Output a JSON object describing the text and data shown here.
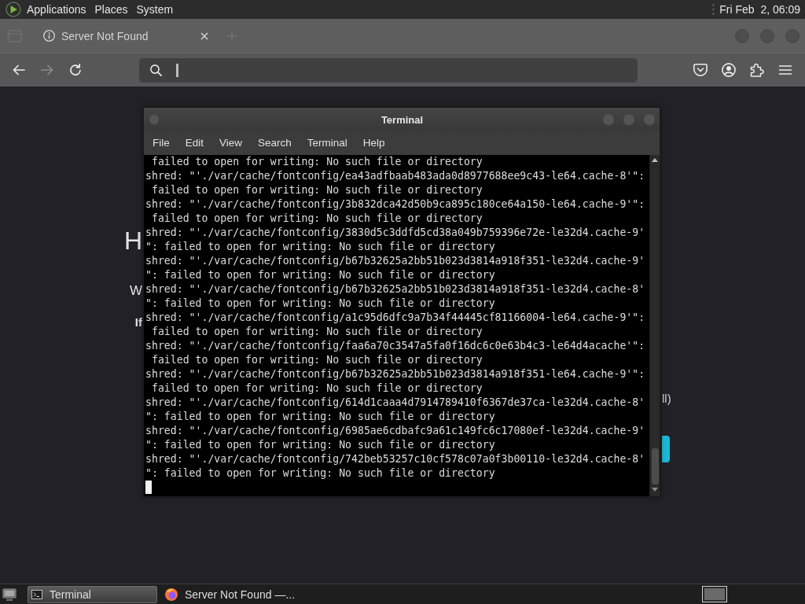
{
  "top_panel": {
    "menus": [
      {
        "label": "Applications"
      },
      {
        "label": "Places"
      },
      {
        "label": "System"
      }
    ],
    "clock": "Fri Feb  2, 06:09"
  },
  "browser": {
    "tabs": [
      {
        "title": "Server Not Found"
      }
    ],
    "nav_buttons": [
      {
        "kind": "back",
        "disabled": false
      },
      {
        "kind": "forward",
        "disabled": true
      },
      {
        "kind": "reload",
        "disabled": false
      }
    ],
    "address_bar": {
      "focused": true
    },
    "page": {
      "left_fragments": [
        {
          "kind": "heading",
          "text": "H"
        },
        {
          "kind": "text",
          "text": "W"
        },
        {
          "kind": "bold",
          "text": "If"
        }
      ],
      "right_fragments": [
        {
          "kind": "text",
          "text": "ll)"
        },
        {
          "kind": "button"
        }
      ]
    }
  },
  "terminal": {
    "title": "Terminal",
    "menu": [
      "File",
      "Edit",
      "View",
      "Search",
      "Terminal",
      "Help"
    ],
    "lines": [
      " failed to open for writing: No such file or directory",
      "shred: \"'./var/cache/fontconfig/ea43adfbaab483ada0d8977688ee9c43-le64.cache-8'\":",
      " failed to open for writing: No such file or directory",
      "shred: \"'./var/cache/fontconfig/3b832dca42d50b9ca895c180ce64a150-le64.cache-9'\":",
      " failed to open for writing: No such file or directory",
      "shred: \"'./var/cache/fontconfig/3830d5c3ddfd5cd38a049b759396e72e-le32d4.cache-9'",
      "\": failed to open for writing: No such file or directory",
      "shred: \"'./var/cache/fontconfig/b67b32625a2bb51b023d3814a918f351-le32d4.cache-9'",
      "\": failed to open for writing: No such file or directory",
      "shred: \"'./var/cache/fontconfig/b67b32625a2bb51b023d3814a918f351-le32d4.cache-8'",
      "\": failed to open for writing: No such file or directory",
      "shred: \"'./var/cache/fontconfig/a1c95d6dfc9a7b34f44445cf81166004-le64.cache-9'\":",
      " failed to open for writing: No such file or directory",
      "shred: \"'./var/cache/fontconfig/faa6a70c3547a5fa0f16dc6c0e63b4c3-le64d4acache'\":",
      " failed to open for writing: No such file or directory",
      "shred: \"'./var/cache/fontconfig/b67b32625a2bb51b023d3814a918f351-le64.cache-9'\":",
      " failed to open for writing: No such file or directory",
      "shred: \"'./var/cache/fontconfig/614d1caaa4d7914789410f6367de37ca-le32d4.cache-8'",
      "\": failed to open for writing: No such file or directory",
      "shred: \"'./var/cache/fontconfig/6985ae6cdbafc9a61c149fc6c17080ef-le32d4.cache-9'",
      "\": failed to open for writing: No such file or directory",
      "shred: \"'./var/cache/fontconfig/742beb53257c10cf578c07a0f3b00110-le32d4.cache-8'",
      "\": failed to open for writing: No such file or directory"
    ],
    "cursor": true
  },
  "taskbar": {
    "tasks": [
      {
        "kind": "terminal",
        "label": "Terminal",
        "selected": true
      },
      {
        "kind": "firefox",
        "label": "Server Not Found —...",
        "selected": false
      }
    ]
  }
}
